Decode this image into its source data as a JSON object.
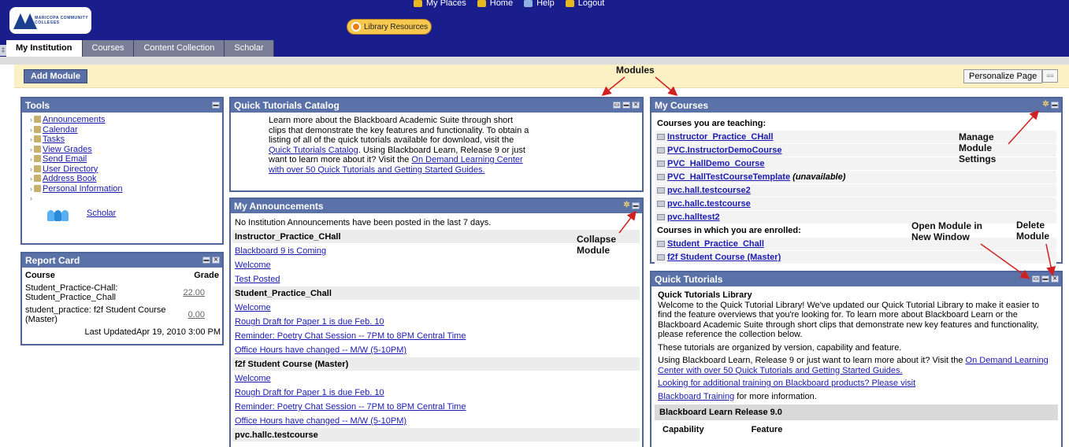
{
  "header": {
    "logo_text": "MARICOPA COMMUNITY COLLEGES",
    "top_nav": [
      "My Places",
      "Home",
      "Help",
      "Logout"
    ],
    "library_button": "Library Resources",
    "tabs": [
      "My Institution",
      "Courses",
      "Content Collection",
      "Scholar"
    ]
  },
  "toolbar": {
    "add_module": "Add Module",
    "personalize": "Personalize Page",
    "page_icon": "≡≡"
  },
  "tools": {
    "title": "Tools",
    "items": [
      "Announcements",
      "Calendar",
      "Tasks",
      "View Grades",
      "Send Email",
      "User Directory",
      "Address Book",
      "Personal Information"
    ],
    "scholar": "Scholar"
  },
  "report_card": {
    "title": "Report Card",
    "col_course": "Course",
    "col_grade": "Grade",
    "rows": [
      {
        "course": "Student_Practice-CHall: Student_Practice_Chall",
        "grade": "22.00"
      },
      {
        "course": "student_practice: f2f Student Course (Master)",
        "grade": "0.00"
      }
    ],
    "updated": "Last UpdatedApr 19, 2010 3:00 PM"
  },
  "quick_tutorials_catalog": {
    "title": "Quick Tutorials Catalog",
    "text1": "Learn more about the Blackboard Academic Suite through short clips that demonstrate the key features and functionality. To obtain a listing of all of the quick tutorials available for download, visit the ",
    "link1": "Quick Tutorials Catalog",
    "text2": ". Using Blackboard Learn, Release 9 or just want to learn more about it? Visit the ",
    "link2": "On Demand Learning Center with over 50 Quick Tutorials and Getting Started Guides."
  },
  "announcements": {
    "title": "My Announcements",
    "lines": [
      {
        "text": "No Institution Announcements have been posted in the last 7 days.",
        "kind": "plain"
      },
      {
        "text": "Instructor_Practice_CHall",
        "kind": "sect"
      },
      {
        "text": "Blackboard 9 is Coming",
        "kind": "link"
      },
      {
        "text": "Welcome",
        "kind": "link"
      },
      {
        "text": "Test Posted",
        "kind": "link"
      },
      {
        "text": "Student_Practice_Chall",
        "kind": "sect"
      },
      {
        "text": "Welcome",
        "kind": "link"
      },
      {
        "text": "Rough Draft for Paper 1 is due Feb. 10",
        "kind": "link"
      },
      {
        "text": "Reminder: Poetry Chat Session -- 7PM to 8PM Central Time",
        "kind": "link"
      },
      {
        "text": "Office Hours have changed -- M/W (5-10PM)",
        "kind": "link"
      },
      {
        "text": "f2f Student Course (Master)",
        "kind": "sect"
      },
      {
        "text": "Welcome",
        "kind": "link"
      },
      {
        "text": "Rough Draft for Paper 1 is due Feb. 10",
        "kind": "link"
      },
      {
        "text": "Reminder: Poetry Chat Session -- 7PM to 8PM Central Time",
        "kind": "link"
      },
      {
        "text": "Office Hours have changed -- M/W (5-10PM)",
        "kind": "link"
      },
      {
        "text": "pvc.hallc.testcourse",
        "kind": "sect"
      }
    ]
  },
  "my_courses": {
    "title": "My Courses",
    "teaching_header": "Courses you are teaching:",
    "teaching": [
      {
        "name": "Instructor_Practice_CHall",
        "note": ""
      },
      {
        "name": "PVC.InstructorDemoCourse",
        "note": ""
      },
      {
        "name": "PVC_HallDemo_Course",
        "note": ""
      },
      {
        "name": "PVC_HallTestCourseTemplate",
        "note": "(unavailable)"
      },
      {
        "name": "pvc.hall.testcourse2",
        "note": ""
      },
      {
        "name": "pvc.hallc.testcourse",
        "note": ""
      },
      {
        "name": "pvc.halltest2",
        "note": ""
      }
    ],
    "enrolled_header": "Courses in which you are enrolled:",
    "enrolled": [
      "Student_Practice_Chall",
      "f2f Student Course (Master)"
    ]
  },
  "quick_tutorials": {
    "title": "Quick Tutorials",
    "library_title": "Quick Tutorials Library",
    "intro": "Welcome to the Quick Tutorial Library! We've updated our Quick Tutorial Library to make it easier to find the feature overviews that you're looking for. To learn more about Blackboard Learn or the Blackboard Academic Suite through short clips that demonstrate new key features and functionality, please reference the collection below.",
    "organized": "These tutorials are organized by version, capability and feature.",
    "using_text": "Using Blackboard Learn, Release 9 or just want to learn more about it? Visit the ",
    "using_link": "On Demand Learning Center with over 50 Quick Tutorials and Getting Started Guides.",
    "training_link": "Looking for additional training on Blackboard products? Please visit",
    "bb_training_link": "Blackboard Training",
    "bb_training_text": " for more information.",
    "release_band": "Blackboard Learn Release 9.0",
    "col_capability": "Capability",
    "col_feature": "Feature"
  },
  "annotations": {
    "modules": "Modules",
    "manage": "Manage Module Settings",
    "collapse": "Collapse Module",
    "open_new": "Open Module in New Window",
    "delete": "Delete Module"
  },
  "colors": {
    "header_bg": "#1a1e8c",
    "module_header": "#5a72a8",
    "link": "#1a1ab3"
  }
}
